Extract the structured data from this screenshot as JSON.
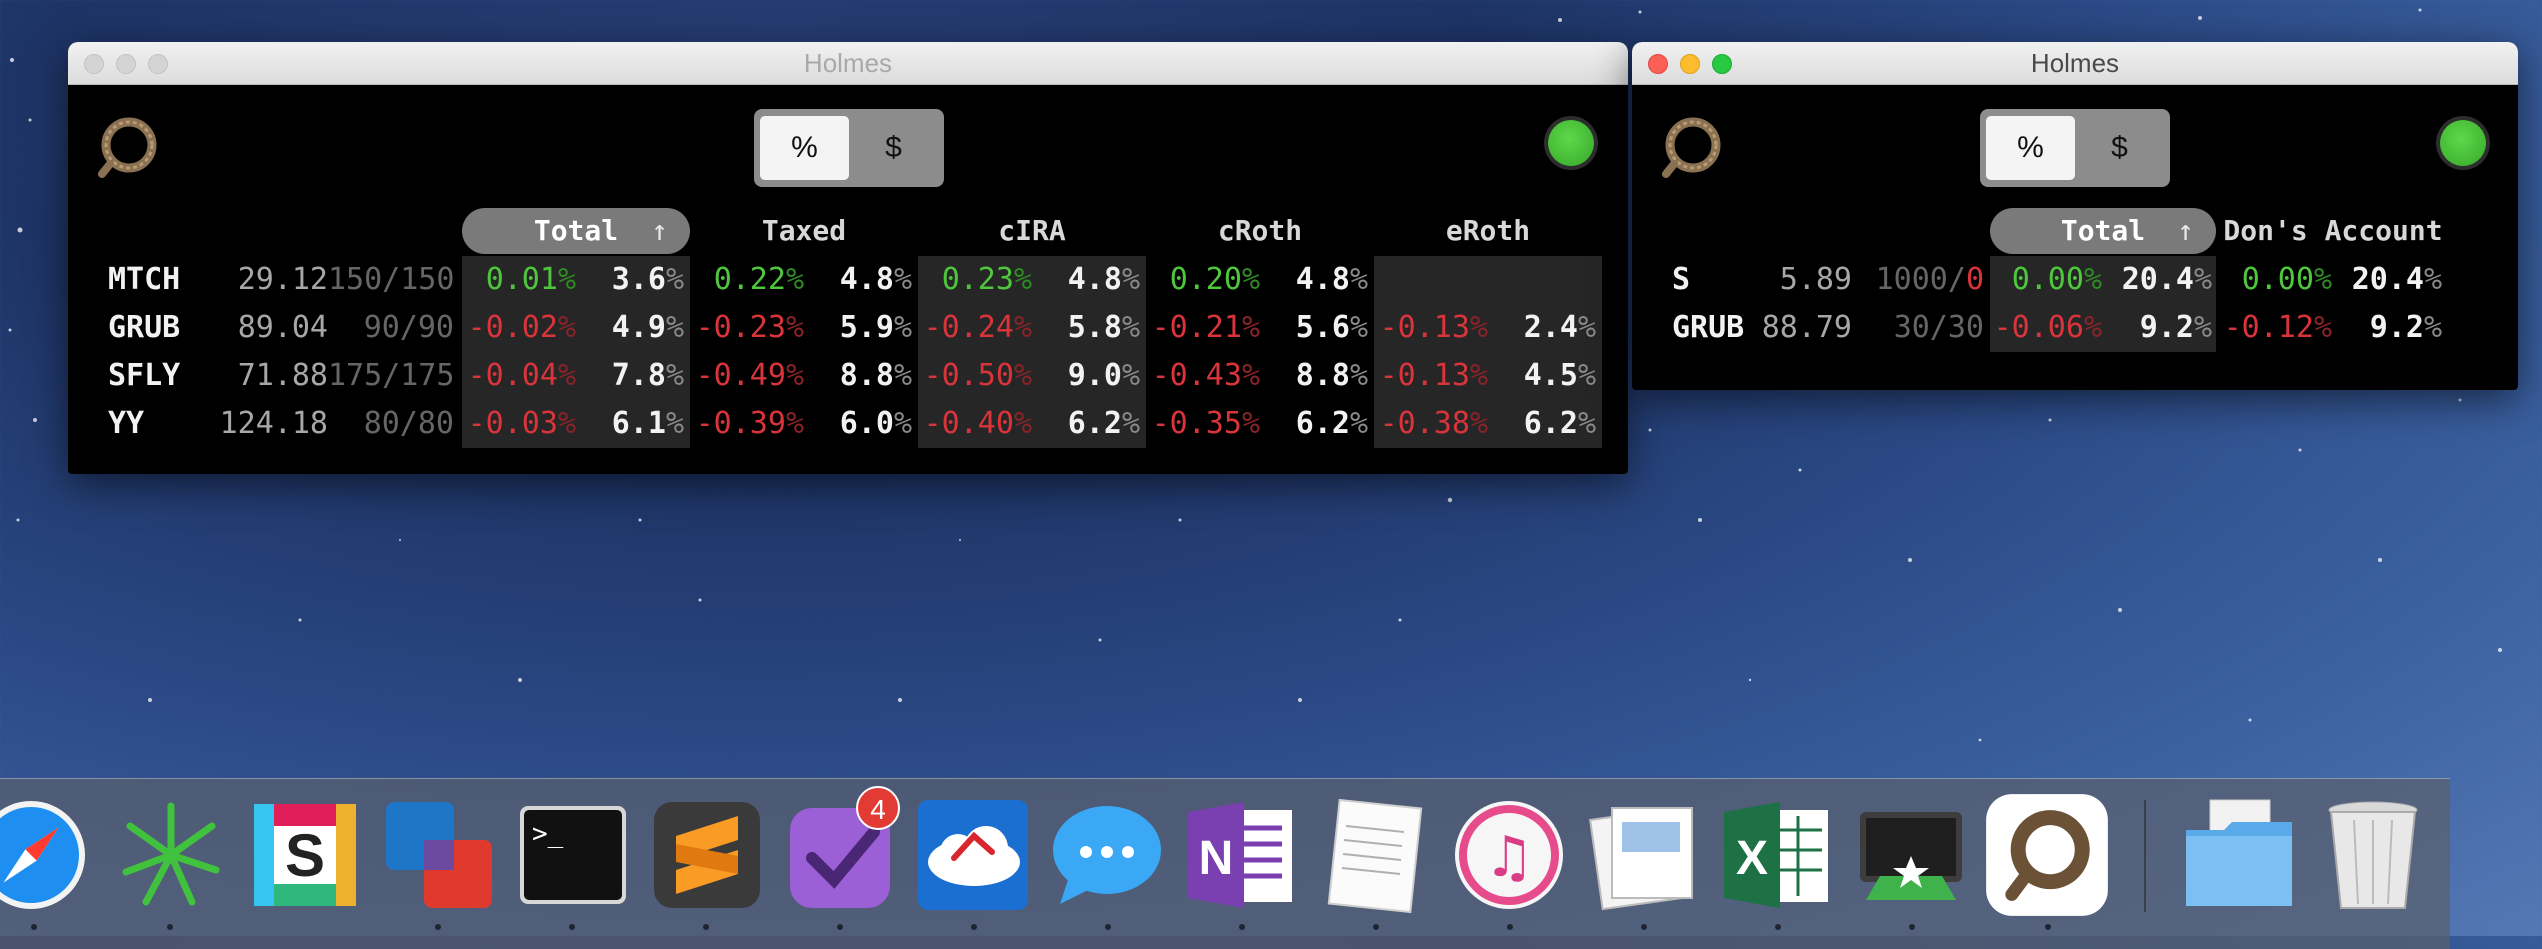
{
  "window1": {
    "title": "Holmes",
    "toggle": {
      "pct": "%",
      "usd": "$"
    },
    "columns": [
      "Total",
      "Taxed",
      "cIRA",
      "cRoth",
      "eRoth"
    ],
    "sort_arrow": "↑",
    "rows": [
      {
        "ticker": "MTCH",
        "price": "29.12",
        "lots": "150/150",
        "cells": [
          [
            "0.01",
            "3.6"
          ],
          [
            "0.22",
            "4.8"
          ],
          [
            "0.23",
            "4.8"
          ],
          [
            "0.20",
            "4.8"
          ],
          [
            "",
            ""
          ]
        ]
      },
      {
        "ticker": "GRUB",
        "price": "89.04",
        "lots": "90/90",
        "cells": [
          [
            "-0.02",
            "4.9"
          ],
          [
            "-0.23",
            "5.9"
          ],
          [
            "-0.24",
            "5.8"
          ],
          [
            "-0.21",
            "5.6"
          ],
          [
            "-0.13",
            "2.4"
          ]
        ]
      },
      {
        "ticker": "SFLY",
        "price": "71.88",
        "lots": "175/175",
        "cells": [
          [
            "-0.04",
            "7.8"
          ],
          [
            "-0.49",
            "8.8"
          ],
          [
            "-0.50",
            "9.0"
          ],
          [
            "-0.43",
            "8.8"
          ],
          [
            "-0.13",
            "4.5"
          ]
        ]
      },
      {
        "ticker": "YY",
        "price": "124.18",
        "lots": "80/80",
        "cells": [
          [
            "-0.03",
            "6.1"
          ],
          [
            "-0.39",
            "6.0"
          ],
          [
            "-0.40",
            "6.2"
          ],
          [
            "-0.35",
            "6.2"
          ],
          [
            "-0.38",
            "6.2"
          ]
        ]
      }
    ]
  },
  "window2": {
    "title": "Holmes",
    "toggle": {
      "pct": "%",
      "usd": "$"
    },
    "columns": [
      "Total",
      "Don's Account"
    ],
    "sort_arrow": "↑",
    "rows": [
      {
        "ticker": "S",
        "price": "5.89",
        "lots_a": "1000/",
        "lots_b": "0",
        "cells": [
          [
            "0.00",
            "20.4"
          ],
          [
            "0.00",
            "20.4"
          ]
        ]
      },
      {
        "ticker": "GRUB",
        "price": "88.79",
        "lots_a": "30/30",
        "lots_b": "",
        "cells": [
          [
            "-0.06",
            "9.2"
          ],
          [
            "-0.12",
            "9.2"
          ]
        ]
      }
    ]
  },
  "unit": "%",
  "dock": {
    "items": [
      "Safari",
      "Perplexity",
      "Slack",
      "VMware Fusion",
      "Terminal",
      "Sublime Text",
      "OmniFocus",
      "Jump Desktop",
      "Messages",
      "OneNote",
      "TextEdit",
      "iTunes",
      "Preview",
      "Excel",
      "Screens",
      "Holmes",
      "Downloads",
      "Trash"
    ],
    "omnifocus_badge": "4"
  },
  "colors": {
    "green": "#4fc73d",
    "red": "#d8343a",
    "status": "#4ccd38"
  }
}
